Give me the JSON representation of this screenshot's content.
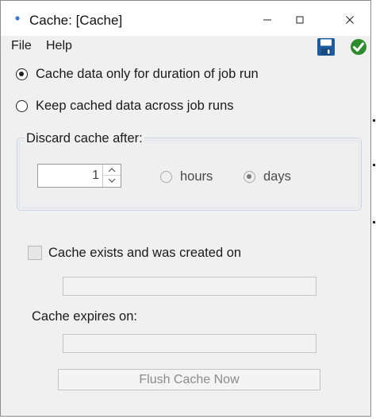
{
  "window": {
    "title": "Cache: [Cache]",
    "controls": [
      "minimize",
      "maximize",
      "close"
    ]
  },
  "menu": {
    "items": [
      {
        "label": "File"
      },
      {
        "label": "Help"
      }
    ],
    "toolbar_icons": [
      "save-icon",
      "ok-check-icon"
    ]
  },
  "cache_mode": {
    "options": [
      {
        "label": "Cache data only for duration of job run",
        "selected": true
      },
      {
        "label": "Keep cached data across job runs",
        "selected": false
      }
    ]
  },
  "discard": {
    "legend": "Discard cache after:",
    "value": "1",
    "units": [
      {
        "label": "hours",
        "selected": false
      },
      {
        "label": "days",
        "selected": true
      }
    ]
  },
  "cache_status": {
    "exists_label": "Cache exists and was created on",
    "exists_checked": false,
    "created_on": "",
    "expires_label": "Cache expires on:",
    "expires_on": ""
  },
  "actions": {
    "flush_label": "Flush Cache Now"
  },
  "colors": {
    "window_bg": "#f0f0f0",
    "titlebar_bg": "#ffffff",
    "save_icon": "#1e5c9e",
    "ok_icon": "#2e8b2e",
    "app_icon": "#3a78c9"
  }
}
